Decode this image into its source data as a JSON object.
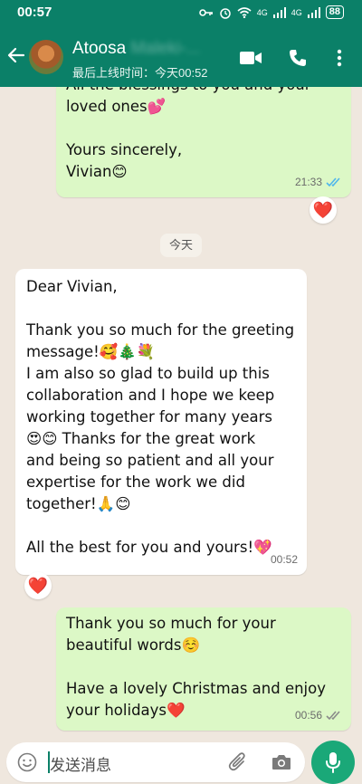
{
  "status_bar": {
    "time": "00:57",
    "battery": "88",
    "network": "4G"
  },
  "header": {
    "contact_name": "Atoosa",
    "contact_name_hidden": "Maleki-...",
    "last_seen": "最后上线时间：今天00:52",
    "icons": [
      "back-arrow-icon",
      "video-call-icon",
      "phone-icon",
      "more-options-icon"
    ]
  },
  "messages": [
    {
      "direction": "outgoing",
      "lines": [
        "All the blessings to you and your",
        "loved ones💕",
        "",
        "Yours sincerely,",
        "Vivian😊"
      ],
      "time": "21:33",
      "read": true,
      "reaction": "❤️"
    },
    {
      "type": "date",
      "label": "今天"
    },
    {
      "direction": "incoming",
      "lines": [
        "Dear Vivian,",
        "",
        "Thank you so much for the greeting",
        "message!🥰🎄💐",
        "I am also so glad to build up this",
        "collaboration and I hope we keep",
        "working together for many years",
        "😍😊 Thanks for the great work",
        "and being so patient and all your",
        "expertise for the work we did",
        "together!🙏😊",
        "",
        "All the best for you and yours!💖"
      ],
      "time": "00:52",
      "reaction": "❤️"
    },
    {
      "direction": "outgoing",
      "lines": [
        "Thank you so much for your",
        "beautiful words☺️",
        "",
        "Have a lovely Christmas and enjoy",
        "your holidays❤️"
      ],
      "time": "00:56",
      "read": false
    }
  ],
  "input": {
    "placeholder": "发送消息"
  },
  "colors": {
    "header": "#0b8068",
    "outgoing_bubble": "#dcf8c6",
    "incoming_bubble": "#ffffff",
    "chat_background": "#efe7de",
    "mic_button": "#1aa878",
    "read_tick": "#4fb6ec"
  }
}
